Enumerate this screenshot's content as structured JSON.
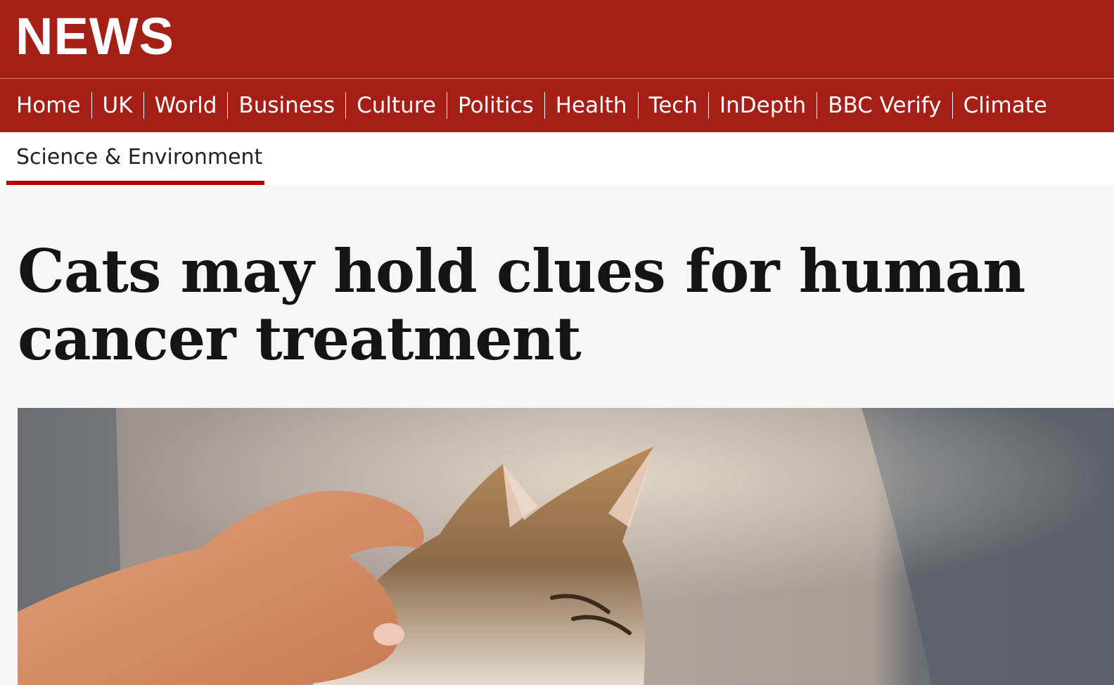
{
  "header": {
    "logo_text": "NEWS",
    "brand_color": "#a51f17"
  },
  "nav": {
    "items": [
      {
        "label": "Home"
      },
      {
        "label": "UK"
      },
      {
        "label": "World"
      },
      {
        "label": "Business"
      },
      {
        "label": "Culture"
      },
      {
        "label": "Politics"
      },
      {
        "label": "Health"
      },
      {
        "label": "Tech"
      },
      {
        "label": "InDepth"
      },
      {
        "label": "BBC Verify"
      },
      {
        "label": "Climate"
      }
    ]
  },
  "subnav": {
    "active_label": "Science & Environment",
    "active_underline_color": "#b80000"
  },
  "article": {
    "headline_line1": "Cats may hold clues for human",
    "headline_line2": "cancer treatment"
  },
  "hero_image": {
    "subject": "cat-being-stroked-photo"
  }
}
